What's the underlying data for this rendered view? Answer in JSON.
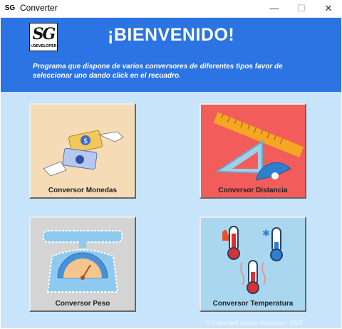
{
  "window": {
    "title": "Converter",
    "app_icon_text": "SG",
    "controls": {
      "minimize": "—",
      "maximize": "☐",
      "close": "✕"
    }
  },
  "header": {
    "logo_text": "SG",
    "logo_subtext": "<DEVELOPER>",
    "welcome": "¡BIENVENIDO!",
    "description": "Programa que dispone de varios conversores de diferentes tipos favor de seleccionar uno dando click en el recuadro."
  },
  "cards": [
    {
      "label": "Conversor Monedas",
      "icon": "money-exchange-icon",
      "color": "#f5dcb7"
    },
    {
      "label": "Conversor Distancia",
      "icon": "ruler-protractor-icon",
      "color": "#f25c5b"
    },
    {
      "label": "Conversor Peso",
      "icon": "scale-icon",
      "color": "#d4d4d4"
    },
    {
      "label": "Conversor Temperatura",
      "icon": "thermometers-icon",
      "color": "#a9d7ef"
    }
  ],
  "footer": {
    "copyright": "© Copyrigth Sergio González - 2023"
  },
  "colors": {
    "header": "#2c73e3",
    "background": "#c8e4fb"
  }
}
